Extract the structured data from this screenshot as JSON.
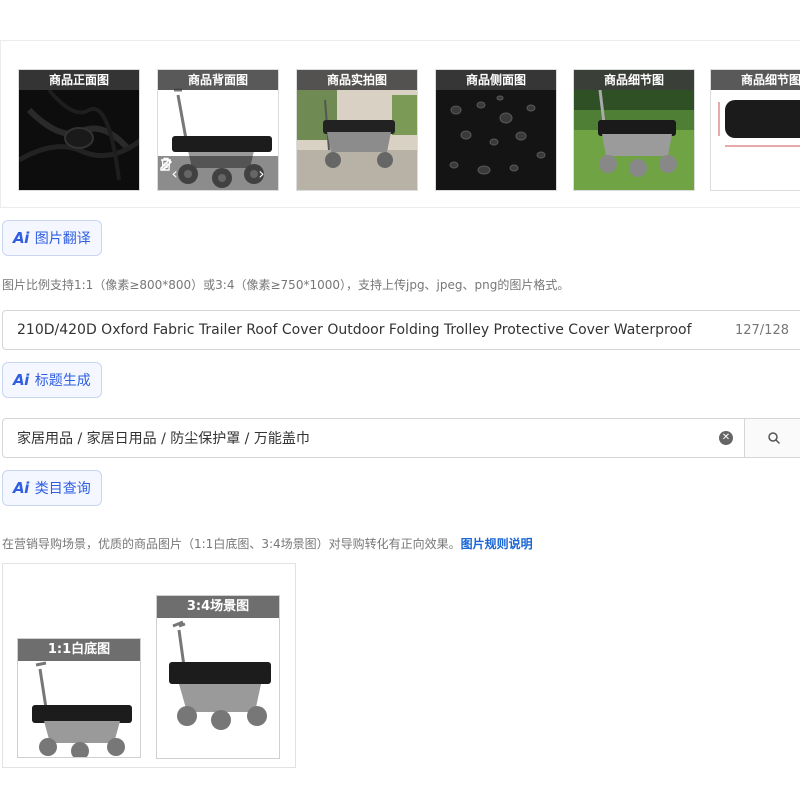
{
  "gallery": {
    "items": [
      {
        "label": "商品正面图",
        "image": "black-fabric"
      },
      {
        "label": "商品背面图",
        "image": "cart-cover"
      },
      {
        "label": "商品实拍图",
        "image": "cart-outdoor"
      },
      {
        "label": "商品侧面图",
        "image": "waterproof-drops"
      },
      {
        "label": "商品细节图",
        "image": "cart-grass"
      },
      {
        "label": "商品细节图",
        "image": "cushion-size"
      }
    ],
    "hover_actions": [
      "prev-icon",
      "edit-icon",
      "delete-icon",
      "next-icon"
    ]
  },
  "ai_translate": {
    "logo": "Ai",
    "label": "图片翻译"
  },
  "image_hint": "图片比例支持1:1（像素≥800*800）或3:4（像素≥750*1000），支持上传jpg、jpeg、png的图片格式。",
  "title_field": {
    "value": "210D/420D Oxford Fabric  Trailer Roof Cover Outdoor Folding Trolley Protective Cover Waterproof",
    "count": "127/128"
  },
  "ai_title": {
    "logo": "Ai",
    "label": "标题生成"
  },
  "category_field": {
    "value": "家居用品 / 家居日用品 / 防尘保护罩 / 万能盖巾"
  },
  "ai_category": {
    "logo": "Ai",
    "label": "类目查询"
  },
  "marketing_hint": {
    "text": "在营销导购场景，优质的商品图片（1:1白底图、3:4场景图）对导购转化有正向效果。",
    "link": "图片规则说明"
  },
  "bottom": {
    "white_bg": {
      "label": "1:1白底图"
    },
    "scene": {
      "label": "3:4场景图"
    }
  },
  "colors": {
    "accent": "#2f5fe0",
    "link": "#1a66d6"
  }
}
